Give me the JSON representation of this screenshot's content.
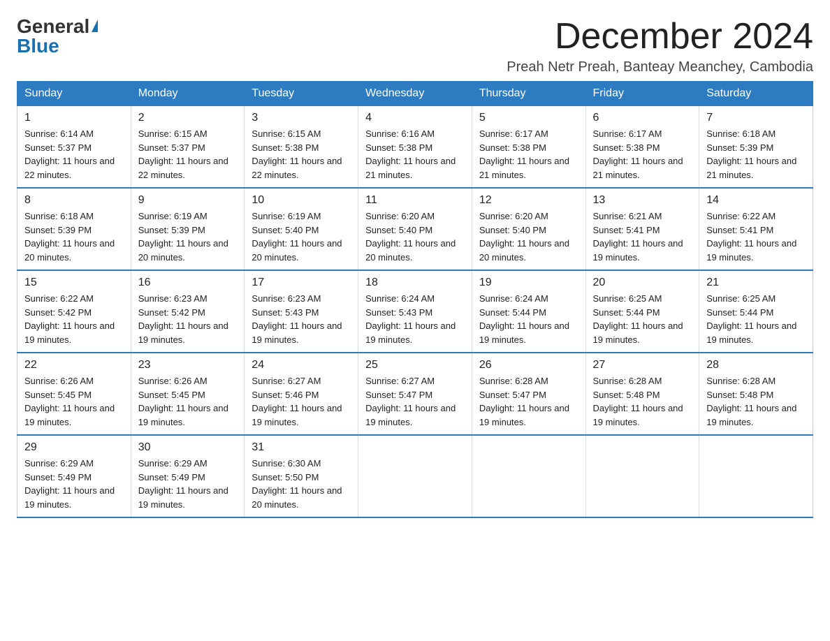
{
  "logo": {
    "line1": "General",
    "triangle": "▶",
    "line2": "Blue"
  },
  "title": "December 2024",
  "subtitle": "Preah Netr Preah, Banteay Meanchey, Cambodia",
  "days_of_week": [
    "Sunday",
    "Monday",
    "Tuesday",
    "Wednesday",
    "Thursday",
    "Friday",
    "Saturday"
  ],
  "weeks": [
    [
      {
        "day": "1",
        "sunrise": "6:14 AM",
        "sunset": "5:37 PM",
        "daylight": "11 hours and 22 minutes."
      },
      {
        "day": "2",
        "sunrise": "6:15 AM",
        "sunset": "5:37 PM",
        "daylight": "11 hours and 22 minutes."
      },
      {
        "day": "3",
        "sunrise": "6:15 AM",
        "sunset": "5:38 PM",
        "daylight": "11 hours and 22 minutes."
      },
      {
        "day": "4",
        "sunrise": "6:16 AM",
        "sunset": "5:38 PM",
        "daylight": "11 hours and 21 minutes."
      },
      {
        "day": "5",
        "sunrise": "6:17 AM",
        "sunset": "5:38 PM",
        "daylight": "11 hours and 21 minutes."
      },
      {
        "day": "6",
        "sunrise": "6:17 AM",
        "sunset": "5:38 PM",
        "daylight": "11 hours and 21 minutes."
      },
      {
        "day": "7",
        "sunrise": "6:18 AM",
        "sunset": "5:39 PM",
        "daylight": "11 hours and 21 minutes."
      }
    ],
    [
      {
        "day": "8",
        "sunrise": "6:18 AM",
        "sunset": "5:39 PM",
        "daylight": "11 hours and 20 minutes."
      },
      {
        "day": "9",
        "sunrise": "6:19 AM",
        "sunset": "5:39 PM",
        "daylight": "11 hours and 20 minutes."
      },
      {
        "day": "10",
        "sunrise": "6:19 AM",
        "sunset": "5:40 PM",
        "daylight": "11 hours and 20 minutes."
      },
      {
        "day": "11",
        "sunrise": "6:20 AM",
        "sunset": "5:40 PM",
        "daylight": "11 hours and 20 minutes."
      },
      {
        "day": "12",
        "sunrise": "6:20 AM",
        "sunset": "5:40 PM",
        "daylight": "11 hours and 20 minutes."
      },
      {
        "day": "13",
        "sunrise": "6:21 AM",
        "sunset": "5:41 PM",
        "daylight": "11 hours and 19 minutes."
      },
      {
        "day": "14",
        "sunrise": "6:22 AM",
        "sunset": "5:41 PM",
        "daylight": "11 hours and 19 minutes."
      }
    ],
    [
      {
        "day": "15",
        "sunrise": "6:22 AM",
        "sunset": "5:42 PM",
        "daylight": "11 hours and 19 minutes."
      },
      {
        "day": "16",
        "sunrise": "6:23 AM",
        "sunset": "5:42 PM",
        "daylight": "11 hours and 19 minutes."
      },
      {
        "day": "17",
        "sunrise": "6:23 AM",
        "sunset": "5:43 PM",
        "daylight": "11 hours and 19 minutes."
      },
      {
        "day": "18",
        "sunrise": "6:24 AM",
        "sunset": "5:43 PM",
        "daylight": "11 hours and 19 minutes."
      },
      {
        "day": "19",
        "sunrise": "6:24 AM",
        "sunset": "5:44 PM",
        "daylight": "11 hours and 19 minutes."
      },
      {
        "day": "20",
        "sunrise": "6:25 AM",
        "sunset": "5:44 PM",
        "daylight": "11 hours and 19 minutes."
      },
      {
        "day": "21",
        "sunrise": "6:25 AM",
        "sunset": "5:44 PM",
        "daylight": "11 hours and 19 minutes."
      }
    ],
    [
      {
        "day": "22",
        "sunrise": "6:26 AM",
        "sunset": "5:45 PM",
        "daylight": "11 hours and 19 minutes."
      },
      {
        "day": "23",
        "sunrise": "6:26 AM",
        "sunset": "5:45 PM",
        "daylight": "11 hours and 19 minutes."
      },
      {
        "day": "24",
        "sunrise": "6:27 AM",
        "sunset": "5:46 PM",
        "daylight": "11 hours and 19 minutes."
      },
      {
        "day": "25",
        "sunrise": "6:27 AM",
        "sunset": "5:47 PM",
        "daylight": "11 hours and 19 minutes."
      },
      {
        "day": "26",
        "sunrise": "6:28 AM",
        "sunset": "5:47 PM",
        "daylight": "11 hours and 19 minutes."
      },
      {
        "day": "27",
        "sunrise": "6:28 AM",
        "sunset": "5:48 PM",
        "daylight": "11 hours and 19 minutes."
      },
      {
        "day": "28",
        "sunrise": "6:28 AM",
        "sunset": "5:48 PM",
        "daylight": "11 hours and 19 minutes."
      }
    ],
    [
      {
        "day": "29",
        "sunrise": "6:29 AM",
        "sunset": "5:49 PM",
        "daylight": "11 hours and 19 minutes."
      },
      {
        "day": "30",
        "sunrise": "6:29 AM",
        "sunset": "5:49 PM",
        "daylight": "11 hours and 19 minutes."
      },
      {
        "day": "31",
        "sunrise": "6:30 AM",
        "sunset": "5:50 PM",
        "daylight": "11 hours and 20 minutes."
      },
      null,
      null,
      null,
      null
    ]
  ]
}
